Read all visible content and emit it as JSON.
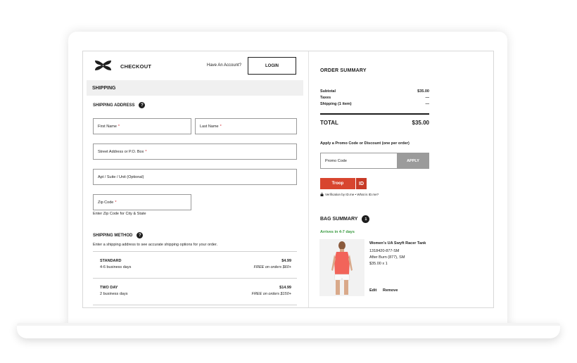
{
  "header": {
    "title": "CHECKOUT",
    "have_account": "Have An Account?",
    "login_label": "LOGIN"
  },
  "shipping": {
    "section_title": "SHIPPING",
    "address_heading": "SHIPPING ADDRESS",
    "help_glyph": "?",
    "fields": {
      "first_name": "First Name",
      "last_name": "Last Name",
      "street": "Street Address or P.O. Box",
      "apt": "Apt / Suite / Unit (Optional)",
      "zip": "Zip Code"
    },
    "required_mark": "*",
    "zip_hint": "Enter Zip Code for City & State",
    "method_heading": "SHIPPING METHOD",
    "method_hint": "Enter a shipping address to see accurate shipping options for your order.",
    "methods": [
      {
        "name": "STANDARD",
        "days": "4-6 business days",
        "price": "$4.99",
        "free": "FREE on orders $60+"
      },
      {
        "name": "TWO DAY",
        "days": "2 business days",
        "price": "$14.99",
        "free": "FREE on orders $150+"
      }
    ]
  },
  "summary": {
    "title": "ORDER SUMMARY",
    "subtotal_label": "Subtotal",
    "subtotal_value": "$35.00",
    "taxes_label": "Taxes",
    "taxes_value": "—",
    "shipping_label": "Shipping (1 item)",
    "shipping_value": "—",
    "total_label": "TOTAL",
    "total_value": "$35.00",
    "promo_label": "Apply a Promo Code or Discount (one per order)",
    "promo_placeholder": "Promo Code",
    "apply_label": "APPLY",
    "troop_label": "Troop",
    "troop_id": "ID",
    "verification_text": "Verification by ID.me • What is ID.me?"
  },
  "bag": {
    "title": "BAG SUMMARY",
    "count": "1",
    "arrives": "Arrives in 4-7 days",
    "product": {
      "name": "Women's UA Swyft Racer Tank",
      "sku": "1318420-877-SM",
      "variant": "After Burn (877), SM",
      "price_qty": "$35.00 x 1",
      "edit_label": "Edit",
      "remove_label": "Remove"
    }
  },
  "colors": {
    "accent_green": "#3a9b41",
    "troop_red": "#d8452f",
    "required_red": "#d2232a"
  }
}
